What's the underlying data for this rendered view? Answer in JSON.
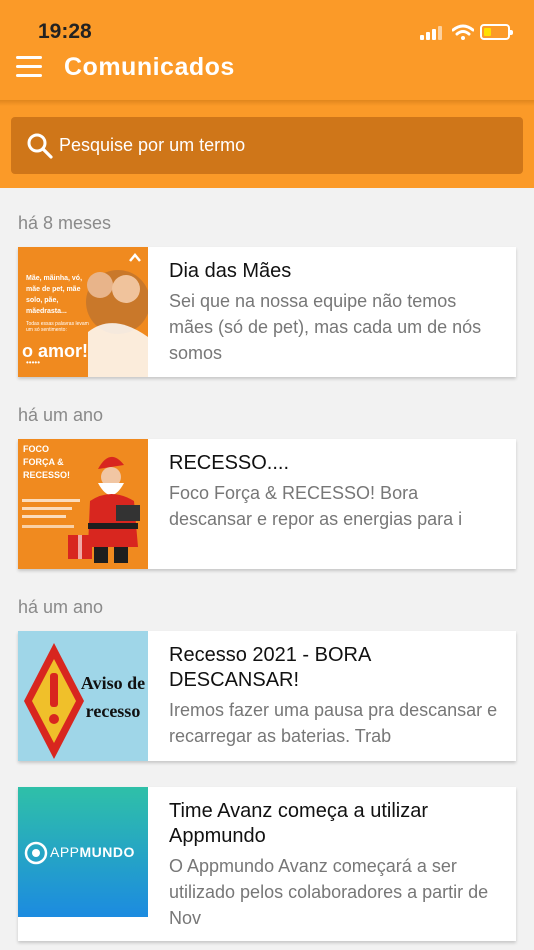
{
  "status": {
    "time": "19:28"
  },
  "header": {
    "title": "Comunicados"
  },
  "search": {
    "placeholder": "Pesquise por um termo"
  },
  "sections": [
    {
      "label": "há 8 meses"
    },
    {
      "label": "há um ano"
    },
    {
      "label": "há um ano"
    }
  ],
  "posts": [
    {
      "title": "Dia das Mães",
      "excerpt": "Sei que na nossa equipe não temos mães (só de pet), mas cada um de nós somos",
      "thumb": {
        "text1": "Mãe, mãinha, vó, mãe de pet, mãe solo, pãe, mãedrasta...",
        "text2": "Todas essas palavras levam um só sentimento:",
        "text3": "o amor!",
        "bg": "#f08a1f"
      }
    },
    {
      "title": "RECESSO....",
      "excerpt": "Foco Força & RECESSO! Bora descansar e repor as energias para i",
      "thumb": {
        "text1": "FOCO FORÇA & RECESSO!",
        "bg": "#f08a1f"
      }
    },
    {
      "title": "Recesso 2021 - BORA DESCANSAR!",
      "excerpt": "Iremos fazer uma pausa pra descansar e recarregar as baterias. Trab",
      "thumb": {
        "text1": "Aviso de recesso",
        "bg": "#9fd6e8"
      }
    },
    {
      "title": "Time Avanz começa a utilizar Appmundo",
      "excerpt": "O Appmundo Avanz começará a ser utilizado pelos colaboradores a partir de Nov",
      "thumb": {
        "text1": "APP",
        "text2": "MUNDO",
        "bg": "#1fa0d8"
      }
    }
  ],
  "colors": {
    "header": "#fb9a28",
    "search": "#cf7619",
    "background": "#f2f2f2"
  },
  "icons": {
    "menu": "hamburger-menu-icon",
    "search": "search-icon"
  }
}
